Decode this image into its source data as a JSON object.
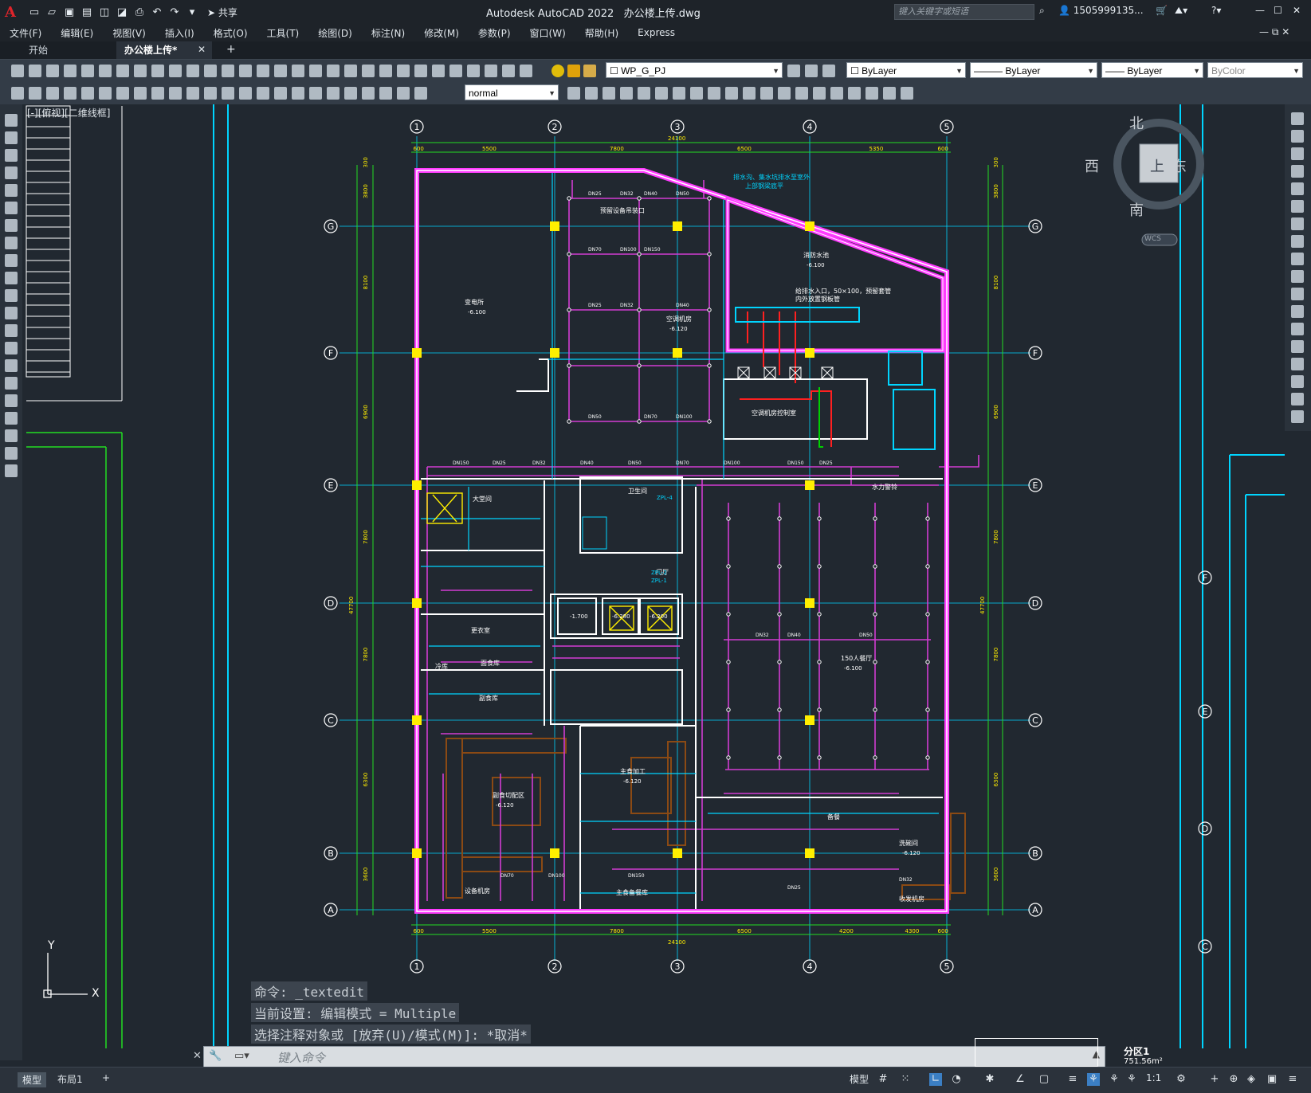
{
  "app": {
    "title": "Autodesk AutoCAD 2022",
    "file": "办公楼上传.dwg",
    "share_label": "共享",
    "search_placeholder": "键入关键字或短语",
    "user": "1505999135...",
    "logo": "A"
  },
  "menu": [
    "文件(F)",
    "编辑(E)",
    "视图(V)",
    "插入(I)",
    "格式(O)",
    "工具(T)",
    "绘图(D)",
    "标注(N)",
    "修改(M)",
    "参数(P)",
    "窗口(W)",
    "帮助(H)",
    "Express"
  ],
  "tabs": [
    {
      "label": "开始",
      "active": false
    },
    {
      "label": "办公楼上传*",
      "active": true
    }
  ],
  "toolbars": {
    "layer": "WP_G_PJ",
    "color": "ByLayer",
    "linetype": "ByLayer",
    "lineweight": "ByLayer",
    "plotstyle": "ByColor",
    "dimstyle": "normal"
  },
  "viewport_label": "[-][俯视][二维线框]",
  "viewcube": {
    "north": "北",
    "south": "南",
    "east": "东",
    "west": "西",
    "top": "上",
    "wcs": "WCS"
  },
  "drawing": {
    "axis_numbers": [
      "1",
      "2",
      "3",
      "4",
      "5"
    ],
    "axis_letters": [
      "G",
      "F",
      "E",
      "D",
      "C",
      "B",
      "A"
    ],
    "right_outline_letters": [
      "F",
      "E",
      "D",
      "C"
    ],
    "top_dims": [
      "600",
      "5500",
      "7800",
      "6500",
      "5350",
      "600"
    ],
    "top_total": "24100",
    "bottom_dims": [
      "600",
      "5500",
      "7800",
      "6500",
      "4200",
      "4300",
      "600"
    ],
    "bottom_total": "24100",
    "left_dims": [
      "300",
      "3800",
      "8100",
      "6900",
      "7800",
      "7800",
      "6300",
      "3600"
    ],
    "left_total": "47700",
    "rooms": [
      {
        "name": "预留设备吊装口"
      },
      {
        "name": "变电所",
        "level": "-6.100"
      },
      {
        "name": "空调机房",
        "level": "-6.120"
      },
      {
        "name": "消防水池",
        "level": "-6.100"
      },
      {
        "name": "空调机房控制室"
      },
      {
        "name": "卫生间"
      },
      {
        "name": "门厅"
      },
      {
        "name": "大堂间"
      },
      {
        "name": "更衣室"
      },
      {
        "name": "冷库"
      },
      {
        "name": "面食库"
      },
      {
        "name": "副食库"
      },
      {
        "name": "副食切配区",
        "level": "-6.120"
      },
      {
        "name": "主食加工",
        "level": "-6.120"
      },
      {
        "name": "主食备餐库"
      },
      {
        "name": "设备机房"
      },
      {
        "name": "150人餐厅",
        "level": "-6.100"
      },
      {
        "name": "备餐"
      },
      {
        "name": "洗碗间",
        "level": "-6.120"
      },
      {
        "name": "收发机房"
      },
      {
        "name": "水力警铃"
      }
    ],
    "notes": [
      "排水沟、集水坑排水至室外",
      "上部钢梁底平",
      "给排水入口，50×100，预留套管",
      "内外放置钢板管"
    ],
    "elevator_levels": [
      "-1.700",
      "-6.280",
      "-6.200"
    ],
    "zpl_labels": [
      "ZPL-4",
      "ZPL-2",
      "ZPL-1"
    ],
    "pipe_size_labels": [
      "DN25",
      "DN32",
      "DN40",
      "DN50",
      "DN70",
      "DN100",
      "DN150"
    ]
  },
  "command": {
    "history": [
      "命令: _textedit",
      "当前设置: 编辑模式 = Multiple",
      "选择注释对象或 [放弃(U)/模式(M)]: *取消*"
    ],
    "placeholder": "键入命令"
  },
  "layout_tabs": [
    "模型",
    "布局1"
  ],
  "status": {
    "model_label": "模型",
    "scale": "1:1",
    "zone_label": "分区1",
    "zone_area": "751.56m²"
  },
  "colors": {
    "background": "#212830",
    "wall": "#ff3cff",
    "pipe": "#d23cd2",
    "grid": "#00d5ff",
    "dimension": "#22dd22",
    "column": "#ffee00",
    "door": "#ffffff",
    "brown": "#8b4a14"
  }
}
